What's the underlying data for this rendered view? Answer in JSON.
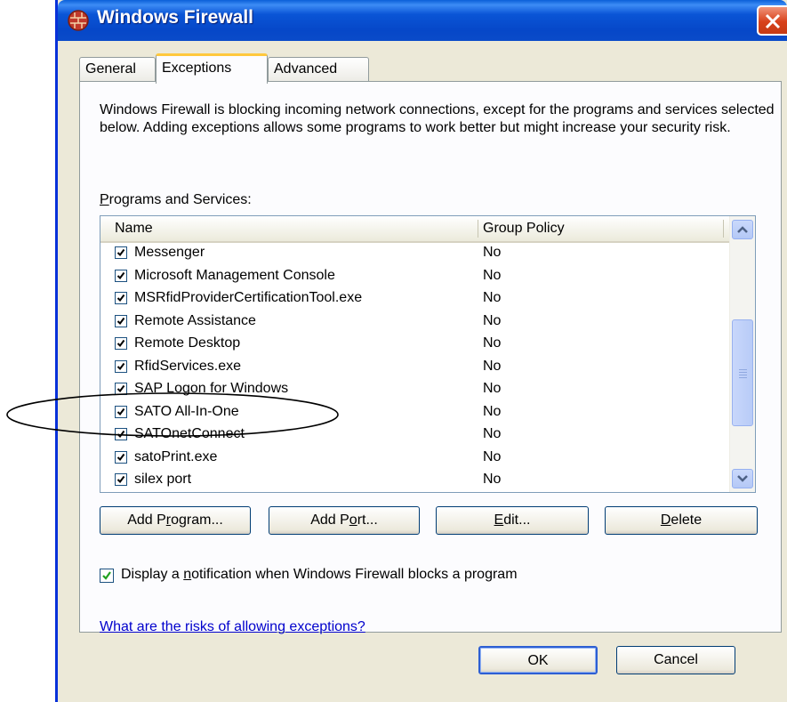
{
  "window": {
    "title": "Windows Firewall"
  },
  "tabs": [
    {
      "label": "General"
    },
    {
      "label": "Exceptions"
    },
    {
      "label": "Advanced"
    }
  ],
  "description": "Windows Firewall is blocking incoming network connections, except for the programs and services selected below. Adding exceptions allows some programs to work better but might increase your security risk.",
  "section_label": {
    "mnemonic": "P",
    "rest": "rograms and Services:"
  },
  "list": {
    "columns": {
      "name": "Name",
      "group_policy": "Group Policy"
    },
    "rows": [
      {
        "name": "Messenger",
        "group_policy": "No",
        "checked": true
      },
      {
        "name": "Microsoft Management Console",
        "group_policy": "No",
        "checked": true
      },
      {
        "name": "MSRfidProviderCertificationTool.exe",
        "group_policy": "No",
        "checked": true
      },
      {
        "name": "Remote Assistance",
        "group_policy": "No",
        "checked": true
      },
      {
        "name": "Remote Desktop",
        "group_policy": "No",
        "checked": true
      },
      {
        "name": "RfidServices.exe",
        "group_policy": "No",
        "checked": true
      },
      {
        "name": "SAP Logon for Windows",
        "group_policy": "No",
        "checked": true
      },
      {
        "name": "SATO All-In-One",
        "group_policy": "No",
        "checked": true
      },
      {
        "name": "SATOnetConnect",
        "group_policy": "No",
        "checked": true
      },
      {
        "name": "satoPrint.exe",
        "group_policy": "No",
        "checked": true
      },
      {
        "name": "silex port",
        "group_policy": "No",
        "checked": true
      }
    ]
  },
  "buttons": {
    "add_program": {
      "pre": "Add P",
      "key": "r",
      "post": "ogram..."
    },
    "add_port": {
      "pre": "Add P",
      "key": "o",
      "post": "rt..."
    },
    "edit": {
      "pre": "",
      "key": "E",
      "post": "dit..."
    },
    "delete": {
      "pre": "",
      "key": "D",
      "post": "elete"
    },
    "ok": "OK",
    "cancel": "Cancel"
  },
  "notification": {
    "checked": true,
    "pre": "Display a ",
    "key": "n",
    "post": "otification when Windows Firewall blocks a program"
  },
  "risk_link": "What are the risks of allowing exceptions?",
  "colors": {
    "titlebar": "#0a55d6",
    "dialog_bg": "#ece9d8",
    "link": "#0000cc",
    "active_tab_accent": "#ffc83c",
    "close_button": "#d8411a"
  },
  "icons": {
    "app": "firewall-brick-icon",
    "close": "close-x-icon",
    "scroll_up": "chevron-up-icon",
    "scroll_down": "chevron-down-icon"
  }
}
